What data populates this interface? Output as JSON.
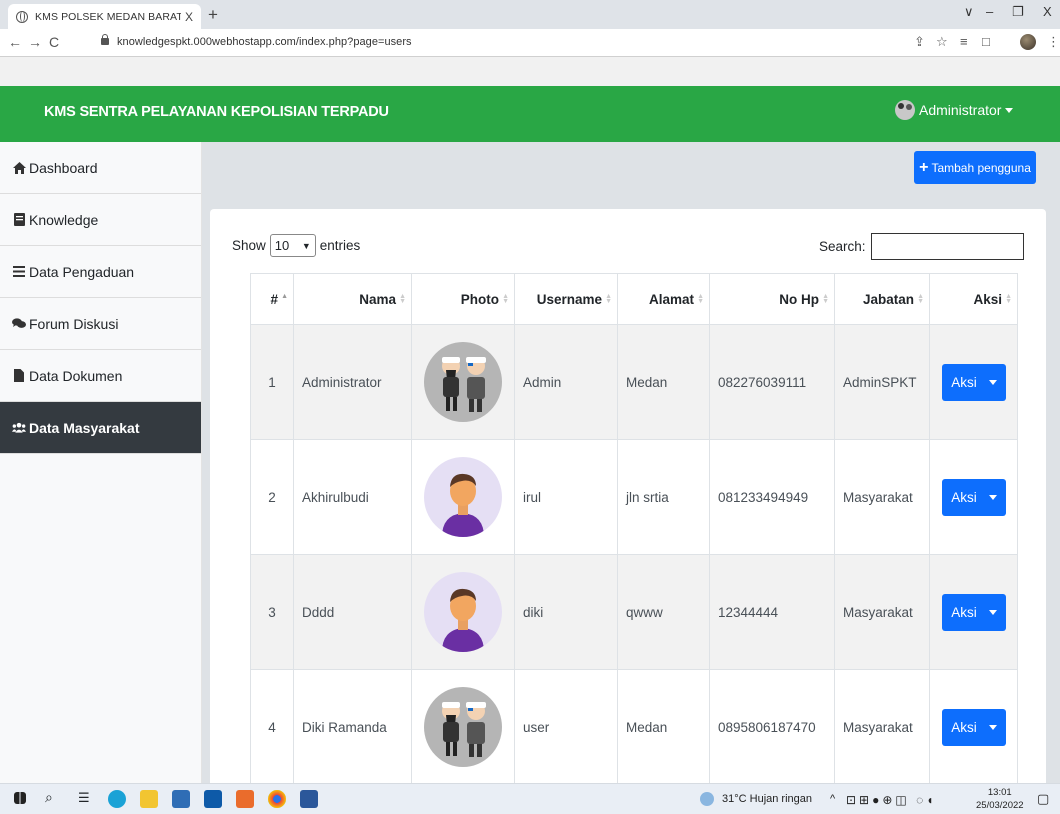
{
  "browser": {
    "tab_title": "KMS POLSEK MEDAN BARAT",
    "tab_close": "X",
    "new_tab": "+",
    "url": "knowledgespkt.000webhostapp.com/index.php?page=users",
    "window_controls": [
      "∨",
      "–",
      "❐",
      "X"
    ]
  },
  "navbar": {
    "brand": "KMS SENTRA PELAYANAN KEPOLISIAN TERPADU",
    "user": "Administrator"
  },
  "sidebar": {
    "items": [
      {
        "label": "Dashboard",
        "icon": "home-icon"
      },
      {
        "label": "Knowledge",
        "icon": "book-icon"
      },
      {
        "label": "Data Pengaduan",
        "icon": "bars-icon"
      },
      {
        "label": "Forum Diskusi",
        "icon": "comments-icon"
      },
      {
        "label": "Data Dokumen",
        "icon": "file-icon"
      },
      {
        "label": "Data Masyarakat",
        "icon": "users-icon",
        "active": true
      }
    ]
  },
  "main": {
    "add_button": "Tambah pengguna",
    "show_label": "Show",
    "entries_value": "10",
    "entries_label": "entries",
    "search_label": "Search:",
    "columns": [
      "#",
      "Nama",
      "Photo",
      "Username",
      "Alamat",
      "No Hp",
      "Jabatan",
      "Aksi"
    ],
    "rows": [
      {
        "no": "1",
        "nama": "Administrator",
        "photo": "police-avatar",
        "username": "Admin",
        "alamat": "Medan",
        "nohp": "082276039111",
        "jabatan": "AdminSPKT",
        "aksi": "Aksi"
      },
      {
        "no": "2",
        "nama": "Akhirulbudi",
        "photo": "person-avatar",
        "username": "irul",
        "alamat": "jln srtia",
        "nohp": "081233494949",
        "jabatan": "Masyarakat",
        "aksi": "Aksi"
      },
      {
        "no": "3",
        "nama": "Dddd",
        "photo": "person-avatar",
        "username": "diki",
        "alamat": "qwww",
        "nohp": "12344444",
        "jabatan": "Masyarakat",
        "aksi": "Aksi"
      },
      {
        "no": "4",
        "nama": "Diki Ramanda",
        "photo": "police-avatar",
        "username": "user",
        "alamat": "Medan",
        "nohp": "0895806187470",
        "jabatan": "Masyarakat",
        "aksi": "Aksi"
      }
    ]
  },
  "taskbar": {
    "weather": "31°C  Hujan ringan",
    "time": "13:01",
    "date": "25/03/2022"
  },
  "colors": {
    "navbar": "#29a745",
    "primary": "#0d6efd",
    "sidebar_active": "#343a40"
  }
}
